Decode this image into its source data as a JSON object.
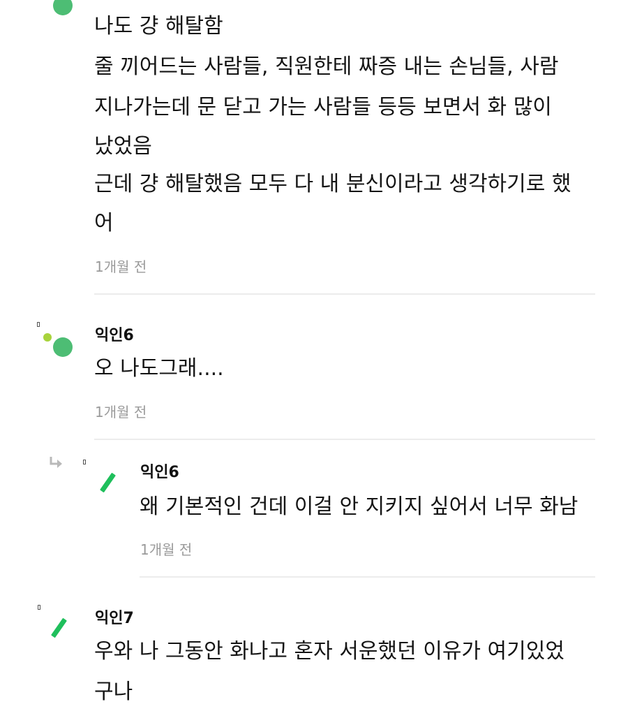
{
  "comments": [
    {
      "author": "",
      "lines": [
        "나도 걍 해탈함",
        "줄 끼어드는 사람들, 직원한테 짜증 내는 손님들, 사람",
        "지나가는데 문 닫고 가는 사람들 등등 보면서 화 많이",
        "났었음",
        "근데 걍 해탈했음 모두 다 내 분신이라고 생각하기로 했",
        "어"
      ],
      "time": "1개월 전"
    },
    {
      "author": "익인6",
      "lines": [
        "오 나도그래...."
      ],
      "time": "1개월 전"
    },
    {
      "author": "익인6",
      "lines": [
        "왜 기본적인 건데 이걸 안 지키지 싶어서 너무 화남"
      ],
      "time": "1개월 전",
      "reply_icon": "reply-arrow-icon"
    },
    {
      "author": "익인7",
      "lines": [
        "우와 나 그동안 화나고 혼자 서운했던 이유가 여기있었",
        "구나"
      ],
      "time": ""
    }
  ],
  "colors": {
    "avatar_green": "#4dbd74",
    "avatar_lime": "#a8d33c",
    "dash_green": "#1fbf5c",
    "timestamp": "#9a9a9a",
    "divider": "#ececec"
  }
}
